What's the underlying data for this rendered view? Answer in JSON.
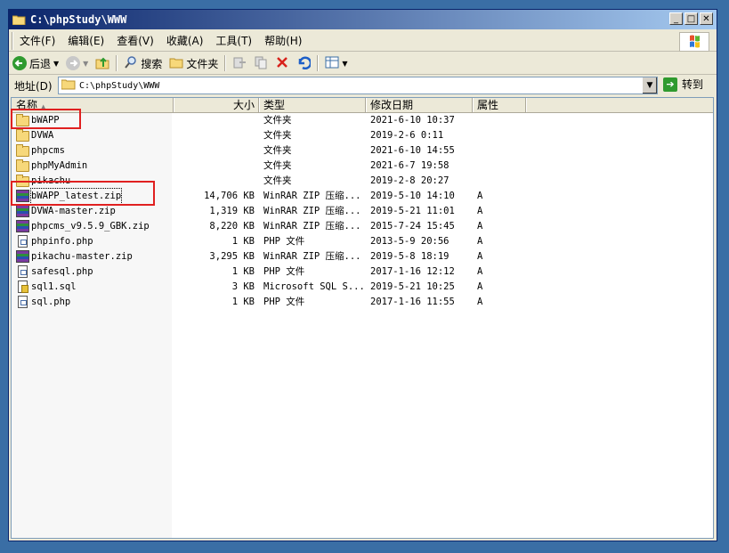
{
  "window": {
    "title": "C:\\phpStudy\\WWW",
    "buttons": [
      "_",
      "□",
      "✕"
    ]
  },
  "menu": [
    "文件(F)",
    "编辑(E)",
    "查看(V)",
    "收藏(A)",
    "工具(T)",
    "帮助(H)"
  ],
  "toolbar": {
    "back_label": "后退",
    "search_label": "搜索",
    "folders_label": "文件夹"
  },
  "address": {
    "label": "地址(D)",
    "value": "C:\\phpStudy\\WWW",
    "go_label": "转到"
  },
  "columns": {
    "name": "名称",
    "size": "大小",
    "type": "类型",
    "modified": "修改日期",
    "attributes": "属性"
  },
  "files": [
    {
      "name": "bWAPP",
      "size": "",
      "type": "文件夹",
      "modified": "2021-6-10 10:37",
      "attr": "",
      "icon": "folder-icon"
    },
    {
      "name": "DVWA",
      "size": "",
      "type": "文件夹",
      "modified": "2019-2-6 0:11",
      "attr": "",
      "icon": "folder-icon"
    },
    {
      "name": "phpcms",
      "size": "",
      "type": "文件夹",
      "modified": "2021-6-10 14:55",
      "attr": "",
      "icon": "folder-icon"
    },
    {
      "name": "phpMyAdmin",
      "size": "",
      "type": "文件夹",
      "modified": "2021-6-7 19:58",
      "attr": "",
      "icon": "folder-icon"
    },
    {
      "name": "pikachu",
      "size": "",
      "type": "文件夹",
      "modified": "2019-2-8 20:27",
      "attr": "",
      "icon": "folder-icon"
    },
    {
      "name": "bWAPP_latest.zip",
      "size": "14,706 KB",
      "type": "WinRAR ZIP 压缩...",
      "modified": "2019-5-10 14:10",
      "attr": "A",
      "icon": "winrar-zip-icon"
    },
    {
      "name": "DVWA-master.zip",
      "size": "1,319 KB",
      "type": "WinRAR ZIP 压缩...",
      "modified": "2019-5-21 11:01",
      "attr": "A",
      "icon": "winrar-zip-icon"
    },
    {
      "name": "phpcms_v9.5.9_GBK.zip",
      "size": "8,220 KB",
      "type": "WinRAR ZIP 压缩...",
      "modified": "2015-7-24 15:45",
      "attr": "A",
      "icon": "winrar-zip-icon"
    },
    {
      "name": "phpinfo.php",
      "size": "1 KB",
      "type": "PHP 文件",
      "modified": "2013-5-9 20:56",
      "attr": "A",
      "icon": "php-file-icon"
    },
    {
      "name": "pikachu-master.zip",
      "size": "3,295 KB",
      "type": "WinRAR ZIP 压缩...",
      "modified": "2019-5-8 18:19",
      "attr": "A",
      "icon": "winrar-zip-icon"
    },
    {
      "name": "safesql.php",
      "size": "1 KB",
      "type": "PHP 文件",
      "modified": "2017-1-16 12:12",
      "attr": "A",
      "icon": "php-file-icon"
    },
    {
      "name": "sql1.sql",
      "size": "3 KB",
      "type": "Microsoft SQL S...",
      "modified": "2019-5-21 10:25",
      "attr": "A",
      "icon": "sql-file-icon"
    },
    {
      "name": "sql.php",
      "size": "1 KB",
      "type": "PHP 文件",
      "modified": "2017-1-16 11:55",
      "attr": "A",
      "icon": "php-file-icon"
    }
  ],
  "annotation_color": "#e02020"
}
